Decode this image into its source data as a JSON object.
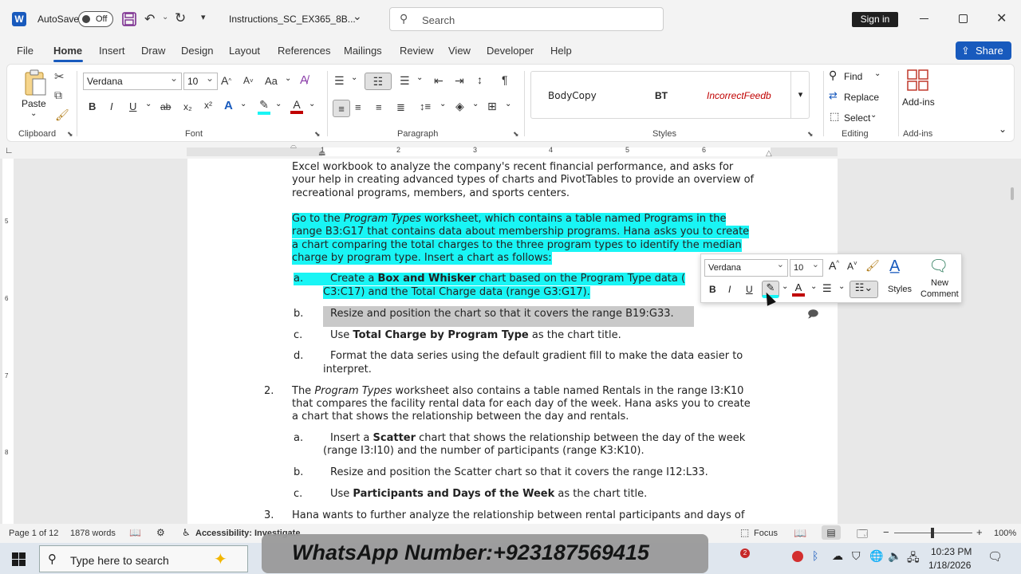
{
  "titlebar": {
    "autosave_label": "AutoSave",
    "autosave_state": "Off",
    "filename": "Instructions_SC_EX365_8B...",
    "search_placeholder": "Search",
    "signin": "Sign in"
  },
  "menu": {
    "tabs": [
      "File",
      "Home",
      "Insert",
      "Draw",
      "Design",
      "Layout",
      "References",
      "Mailings",
      "Review",
      "View",
      "Developer",
      "Help"
    ],
    "active": "Home",
    "share": "Share"
  },
  "ribbon": {
    "clipboard": {
      "paste": "Paste",
      "label": "Clipboard"
    },
    "font": {
      "name": "Verdana",
      "size": "10",
      "label": "Font",
      "b": "B",
      "i": "I",
      "u": "U",
      "strike": "ab",
      "sub": "x₂",
      "sup": "x²",
      "aa": "Aa",
      "grow": "A^",
      "shrink": "A˅"
    },
    "paragraph": {
      "label": "Paragraph"
    },
    "styles": {
      "items": [
        "BodyCopy",
        "BT",
        "IncorrectFeedb"
      ],
      "label": "Styles"
    },
    "editing": {
      "find": "Find",
      "replace": "Replace",
      "select": "Select",
      "label": "Editing"
    },
    "addins": {
      "button": "Add-ins",
      "label": "Add-ins"
    }
  },
  "ruler": {
    "numbers": [
      "1",
      "2",
      "3",
      "4",
      "5",
      "6"
    ]
  },
  "vruler": {
    "numbers": [
      "5",
      "6",
      "7",
      "8"
    ]
  },
  "document": {
    "p0": [
      "Excel workbook to analyze the company's recent financial performance, and asks for",
      "your help in creating advanced types of charts and PivotTables to provide an overview of",
      "recreational programs, members, and sports centers."
    ],
    "p1": {
      "l1a": "Go to the ",
      "l1b": "Program Types",
      "l1c": " worksheet, which contains a table named Programs in the",
      "l2": "range B3:G17 that contains data about membership programs. Hana asks you to create",
      "l3": "a chart comparing the total charges to the three program types to identify the median",
      "l4": "charge by program type. Insert a chart as follows:"
    },
    "a": {
      "marker": "a.",
      "t1": "Create a ",
      "t2": "Box and Whisker",
      "t3": " chart based on the Program Type data (",
      "t4": "C3:C17) and the Total Charge data (range G3:G17)."
    },
    "b": {
      "marker": "b.",
      "text": "Resize and position the chart so that it covers the range B19:G33."
    },
    "c": {
      "marker": "c.",
      "t1": "Use ",
      "t2": "Total Charge by Program Type",
      "t3": " as the chart title."
    },
    "d": {
      "marker": "d.",
      "l1": "Format the data series using the default gradient fill to make the data easier to",
      "l2": "interpret."
    },
    "n2": {
      "marker": "2.",
      "l1a": "The ",
      "l1b": "Program Types",
      "l1c": " worksheet also contains a table named Rentals in the range I3:K10",
      "l2": "that compares the facility rental data for each day of the week. Hana asks you to create",
      "l3": "a chart that shows the relationship between the day and rentals."
    },
    "n2a": {
      "marker": "a.",
      "t1": "Insert a ",
      "t2": "Scatter",
      "t3": " chart that shows the relationship between the day of the week",
      "l2": "(range I3:I10) and the number of participants (range K3:K10)."
    },
    "n2b": {
      "marker": "b.",
      "text": "Resize and position the Scatter chart so that it covers the range I12:L33."
    },
    "n2c": {
      "marker": "c.",
      "t1": "Use ",
      "t2": "Participants and Days of the Week",
      "t3": " as the chart title."
    },
    "n3": {
      "marker": "3.",
      "text": "Hana wants to further analyze the relationship between rental participants and days of"
    }
  },
  "minitoolbar": {
    "font": "Verdana",
    "size": "10",
    "styles": "Styles",
    "new_comment_1": "New",
    "new_comment_2": "Comment",
    "b": "B",
    "i": "I",
    "u": "U"
  },
  "status": {
    "page": "Page 1 of 12",
    "words": "1878 words",
    "accessibility": "Accessibility: Investigate",
    "focus": "Focus",
    "zoom": "100%"
  },
  "overlay": {
    "watermark": "WhatsApp Number:+923187569415"
  },
  "taskbar": {
    "search_placeholder": "Type here to search",
    "badge": "2",
    "time": "10:23 PM",
    "date": "1/18/2026"
  },
  "colors": {
    "highlight": "#19f5f5",
    "accent": "#185abd",
    "fontred": "#c00000"
  }
}
